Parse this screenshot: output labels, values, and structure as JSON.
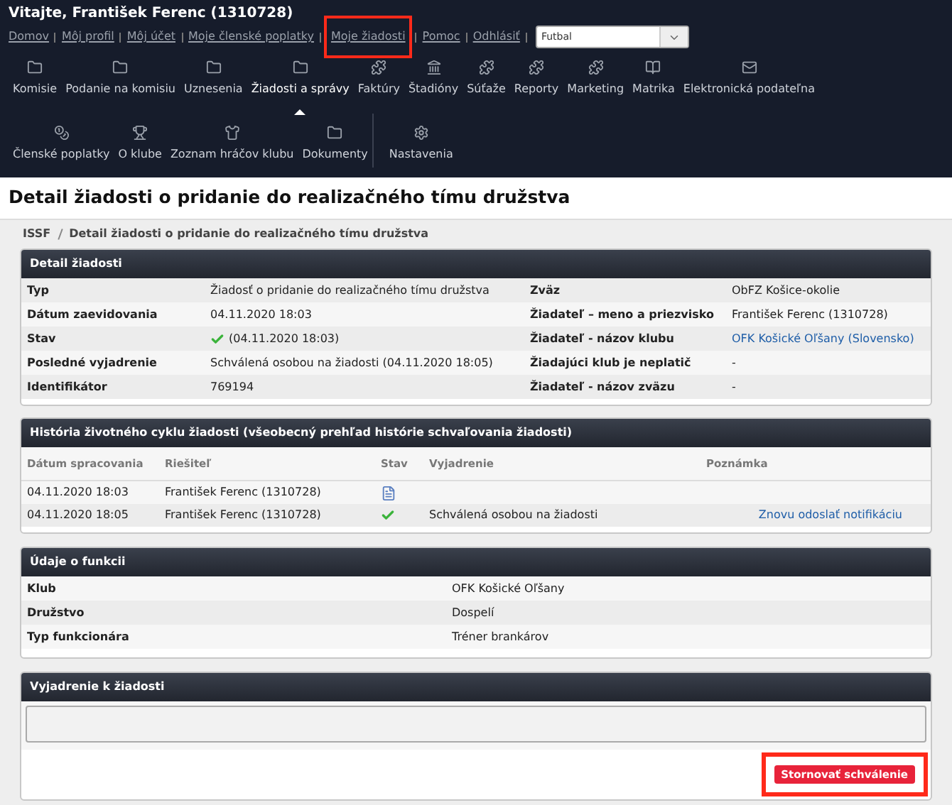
{
  "header": {
    "welcome": "Vitajte, František Ferenc (1310728)",
    "links": [
      {
        "label": "Domov",
        "highlighted": false
      },
      {
        "label": "Môj profil",
        "highlighted": false
      },
      {
        "label": "Môj účet",
        "highlighted": false
      },
      {
        "label": "Moje členské poplatky",
        "highlighted": false
      },
      {
        "label": "Moje žiadosti",
        "highlighted": true
      },
      {
        "label": "Pomoc",
        "highlighted": false
      },
      {
        "label": "Odhlásiť",
        "highlighted": false
      }
    ],
    "sport_select": {
      "value": "Futbal"
    }
  },
  "nav_rows": [
    [
      {
        "label": "Komisie",
        "kind": "folder",
        "selected": false
      },
      {
        "label": "Podanie na komisiu",
        "kind": "folder",
        "selected": false
      },
      {
        "label": "Uznesenia",
        "kind": "folder",
        "selected": false
      },
      {
        "label": "Žiadosti a správy",
        "kind": "folder",
        "selected": true
      },
      {
        "label": "Faktúry",
        "kind": "puzzle",
        "selected": false
      },
      {
        "label": "Štadióny",
        "kind": "stadium",
        "selected": false
      },
      {
        "label": "Súťaže",
        "kind": "puzzle",
        "selected": false
      },
      {
        "label": "Reporty",
        "kind": "puzzle",
        "selected": false
      },
      {
        "label": "Marketing",
        "kind": "puzzle",
        "selected": false
      },
      {
        "label": "Matrika",
        "kind": "register",
        "selected": false
      },
      {
        "label": "Elektronická podateľna",
        "kind": "mail",
        "selected": false
      }
    ],
    [
      {
        "label": "Členské poplatky",
        "kind": "coins",
        "selected": false
      },
      {
        "label": "O klube",
        "kind": "trophy",
        "selected": false
      },
      {
        "label": "Zoznam hráčov klubu",
        "kind": "shirt",
        "selected": false
      },
      {
        "label": "Dokumenty",
        "kind": "folder",
        "selected": false
      },
      {
        "label": "Nastavenia",
        "kind": "gears",
        "selected": false
      }
    ]
  ],
  "page_title": "Detail žiadosti o pridanie do realizačného tímu družstva",
  "breadcrumb": [
    "ISSF",
    "Detail žiadosti o pridanie do realizačného tímu družstva"
  ],
  "detail": {
    "title": "Detail žiadosti",
    "rows": [
      {
        "label": "Typ",
        "value": "Žiadosť o pridanie do realizačného tímu družstva",
        "label_2": "Zväz",
        "value_2": "ObFZ Košice-okolie",
        "value_2_link": false,
        "kind": "text"
      },
      {
        "label": "Dátum zaevidovania",
        "value": "04.11.2020 18:03",
        "label_2": "Žiadateľ – meno a priezvisko",
        "value_2": "František Ferenc (1310728)",
        "value_2_link": false,
        "kind": "text"
      },
      {
        "label": "Stav",
        "value": "(04.11.2020 18:03)",
        "label_2": "Žiadateľ - názov klubu",
        "value_2": "OFK Košické Oľšany (Slovensko)",
        "value_2_link": true,
        "kind": "status"
      },
      {
        "label": "Posledné vyjadrenie",
        "value": "Schválená osobou na žiadosti (04.11.2020 18:05)",
        "label_2": "Žiadajúci klub je neplatič",
        "value_2": "-",
        "value_2_link": false,
        "kind": "text"
      },
      {
        "label": "Identifikátor",
        "value": "769194",
        "label_2": "Žiadateľ - názov zväzu",
        "value_2": "-",
        "value_2_link": false,
        "kind": "text"
      }
    ]
  },
  "history": {
    "title": "História životného cyklu žiadosti (všeobecný prehľad histórie schvaľovania žiadosti)",
    "columns": [
      "Dátum spracovania",
      "Riešiteľ",
      "Stav",
      "Vyjadrenie",
      "Poznámka"
    ],
    "rows": [
      {
        "date": "04.11.2020 18:03",
        "person": "František Ferenc (1310728)",
        "kind": "document"
      },
      {
        "date": "04.11.2020 18:05",
        "person": "František Ferenc (1310728)",
        "kind": "check",
        "statement": "Schválená osobou na žiadosti",
        "action": "Znovu odoslať notifikáciu"
      }
    ]
  },
  "function": {
    "title": "Údaje o funkcii",
    "rows": [
      {
        "label": "Klub",
        "value": "OFK Košické Oľšany"
      },
      {
        "label": "Družstvo",
        "value": "Dospelí"
      },
      {
        "label": "Typ funkcionára",
        "value": "Tréner brankárov"
      }
    ]
  },
  "statement": {
    "title": "Vyjadrenie k žiadosti",
    "button": {
      "label": "Stornovať schválenie",
      "highlighted": true
    }
  }
}
